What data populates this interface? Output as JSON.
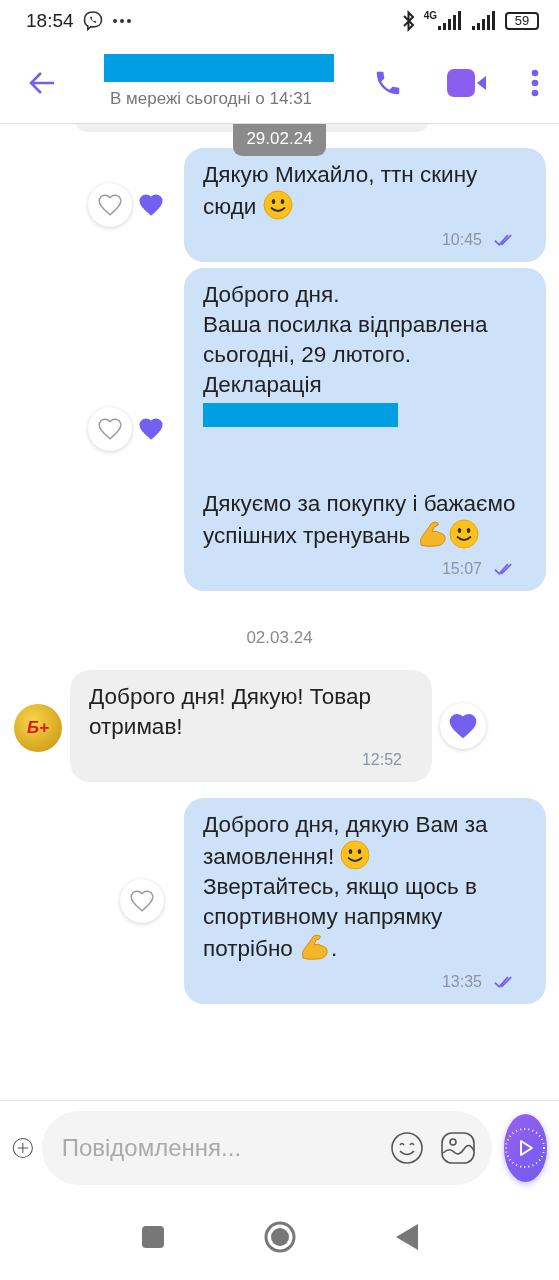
{
  "status_bar": {
    "time": "18:54",
    "network": "4G",
    "battery": "59"
  },
  "header": {
    "name_redacted": true,
    "presence": "В мережі сьогодні о 14:31"
  },
  "messages": [
    {
      "kind": "date",
      "text": "29.02.24",
      "sticky": true
    },
    {
      "kind": "outgoing",
      "paragraphs": [
        [
          {
            "kind": "text",
            "text": "Дякую Михайло, ттн скину сюди "
          },
          {
            "kind": "smiley"
          }
        ]
      ],
      "time": "10:45",
      "read": true,
      "liked": false,
      "partner_heart": true
    },
    {
      "kind": "outgoing",
      "paragraphs": [
        [
          {
            "kind": "text",
            "text": "Доброго дня."
          }
        ],
        [
          {
            "kind": "text",
            "text": "Ваша посилка відправлена сьогодні, 29 лютого."
          }
        ],
        [
          {
            "kind": "text",
            "text": "Декларація"
          }
        ],
        [
          {
            "kind": "redacted"
          }
        ],
        [
          {
            "kind": "text",
            "text": "Дякуємо за покупку і бажаємо успішних тренувань "
          },
          {
            "kind": "muscle"
          },
          {
            "kind": "smiley"
          }
        ]
      ],
      "time": "15:07",
      "read": true,
      "liked": false,
      "partner_heart": true
    },
    {
      "kind": "date",
      "text": "02.03.24",
      "sticky": false
    },
    {
      "kind": "incoming",
      "avatar_text": "Б+",
      "paragraphs": [
        [
          {
            "kind": "text",
            "text": "Доброго дня! Дякую! Товар отримав!"
          }
        ]
      ],
      "time": "12:52",
      "liked": true
    },
    {
      "kind": "outgoing",
      "paragraphs": [
        [
          {
            "kind": "text",
            "text": "Доброго дня, дякую Вам за замовлення! "
          },
          {
            "kind": "smiley"
          }
        ],
        [
          {
            "kind": "text",
            "text": "Звертайтесь, якщо щось в спортивному напрямку потрібно "
          },
          {
            "kind": "muscle"
          },
          {
            "kind": "text",
            "text": "."
          }
        ]
      ],
      "time": "13:35",
      "read": true,
      "liked": false,
      "partner_heart": false
    }
  ],
  "composer": {
    "placeholder": "Повідомлення..."
  }
}
